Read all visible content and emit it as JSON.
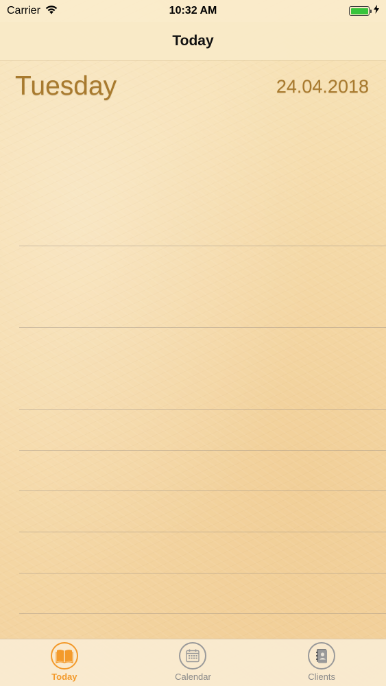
{
  "status_bar": {
    "carrier": "Carrier",
    "time": "10:32 AM",
    "battery_level": 1.0
  },
  "nav": {
    "title": "Today"
  },
  "day": {
    "weekday": "Tuesday",
    "date": "24.04.2018"
  },
  "tab_bar": {
    "tabs": [
      {
        "label": "Today",
        "icon": "book-icon",
        "active": true
      },
      {
        "label": "Calendar",
        "icon": "calendar-icon",
        "active": false
      },
      {
        "label": "Clients",
        "icon": "contacts-book-icon",
        "active": false
      }
    ]
  },
  "colors": {
    "accent": "#f39a2b",
    "heading": "#a87a2e",
    "inactive": "#8a8a8a",
    "battery": "#38c43c"
  }
}
